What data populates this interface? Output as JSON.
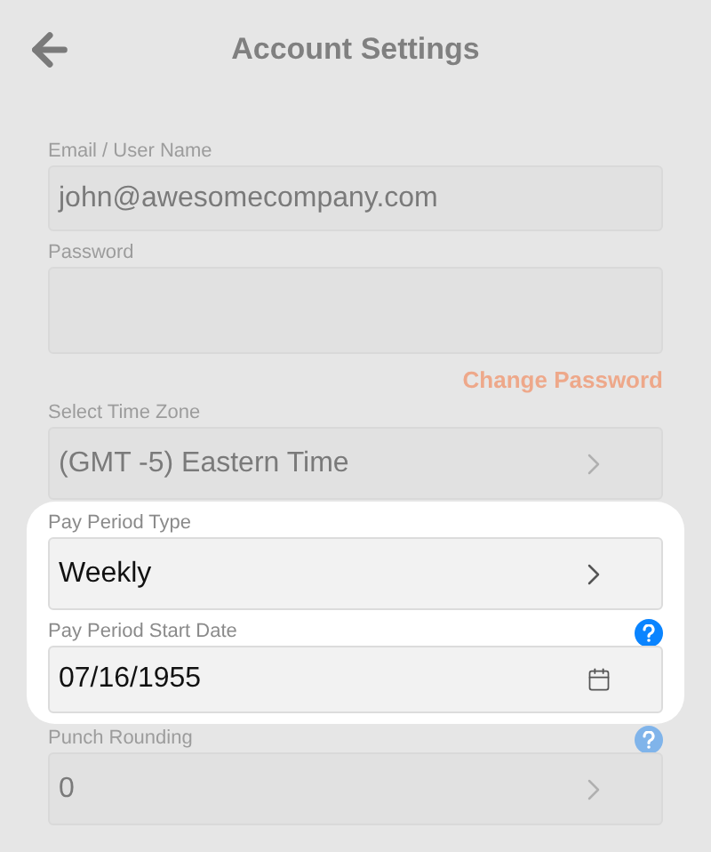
{
  "header": {
    "title": "Account Settings"
  },
  "items": [
    {
      "kind": "text",
      "label": "Email / User Name",
      "value": "john@awesomecompany.com",
      "highlighted": false,
      "help": false
    },
    {
      "kind": "password",
      "label": "Password",
      "highlighted": false,
      "help": false
    },
    {
      "kind": "link",
      "label": "Change Password",
      "highlighted": false
    },
    {
      "kind": "select",
      "label": "Select Time Zone",
      "value": "(GMT -5) Eastern Time",
      "highlighted": false,
      "help": false
    },
    {
      "kind": "select",
      "label": "Pay Period Type",
      "value": "Weekly",
      "highlighted": true,
      "help": false
    },
    {
      "kind": "date",
      "label": "Pay Period Start Date",
      "value": "07/16/1955",
      "highlighted": true,
      "help": true
    },
    {
      "kind": "select",
      "label": "Punch Rounding",
      "value": "0",
      "highlighted": false,
      "help": true
    }
  ]
}
